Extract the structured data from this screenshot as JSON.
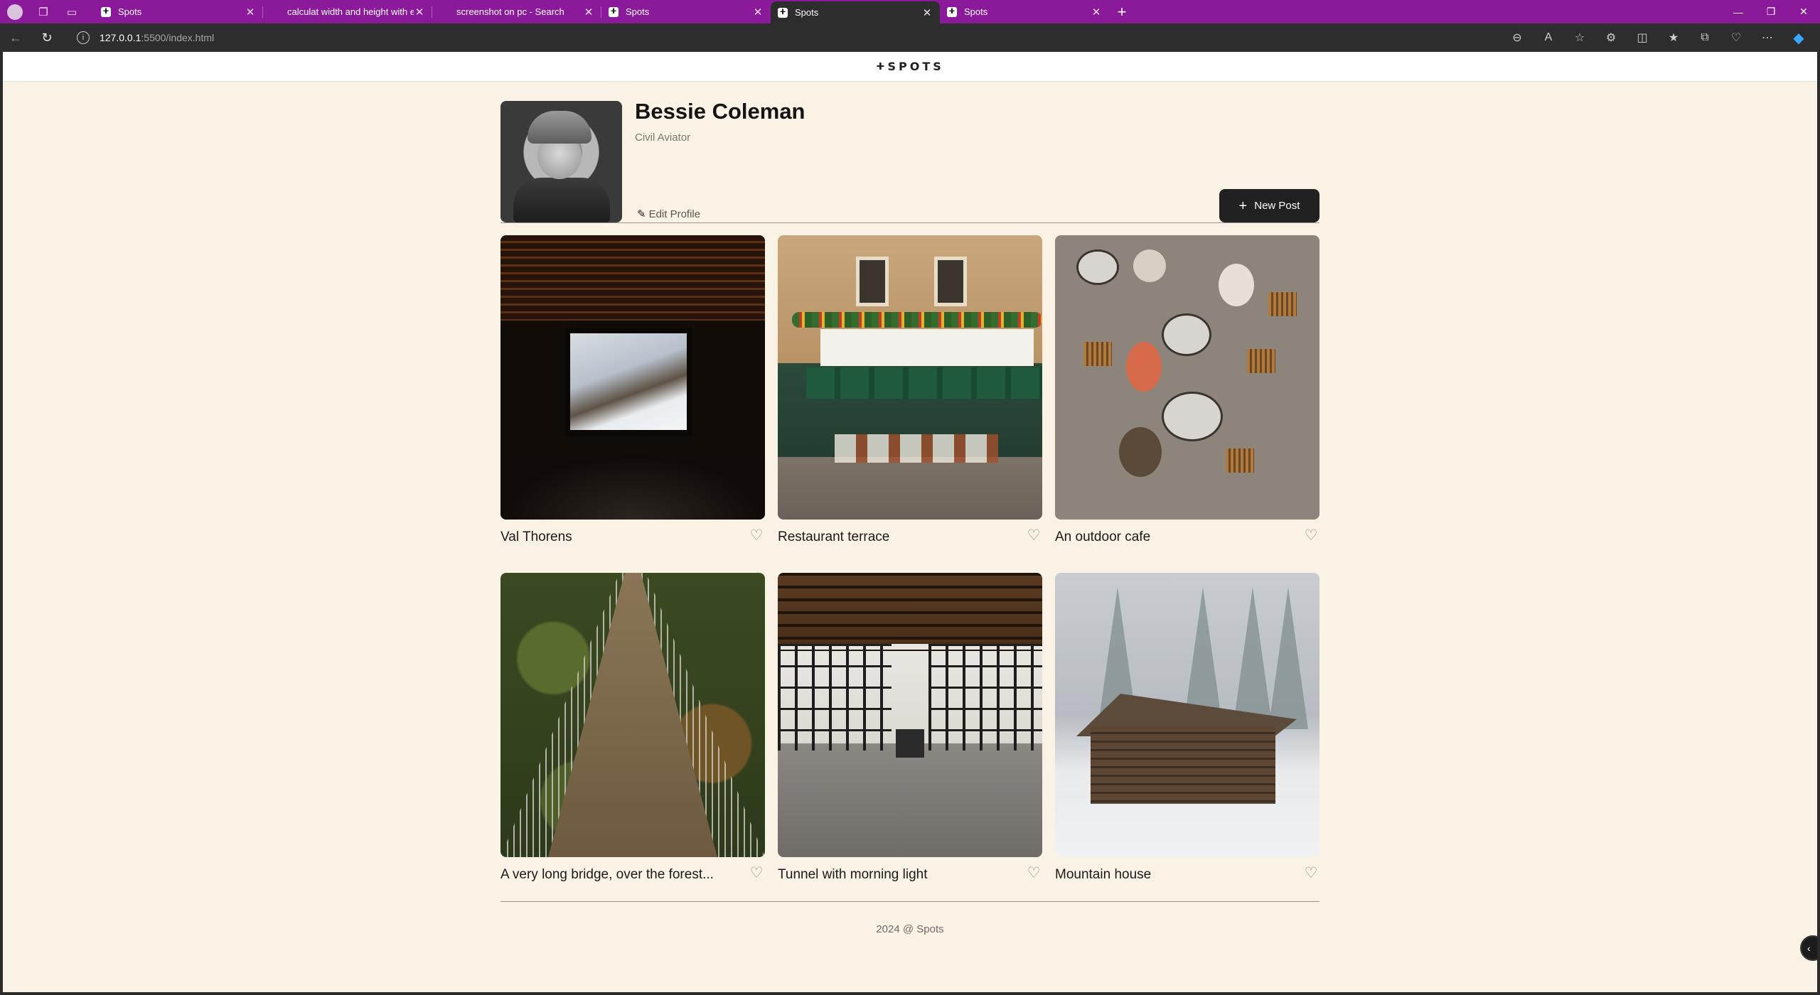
{
  "browser": {
    "tabs": [
      {
        "title": "Spots",
        "favicon": "spots-logo"
      },
      {
        "title": "calculat width and height with em",
        "favicon": "none"
      },
      {
        "title": "screenshot on pc - Search",
        "favicon": "none"
      },
      {
        "title": "Spots",
        "favicon": "spots-logo"
      },
      {
        "title": "Spots",
        "favicon": "spots-logo",
        "active": true
      },
      {
        "title": "Spots",
        "favicon": "spots-logo"
      }
    ],
    "address": {
      "host": "127.0.0.1",
      "path": ":5500/index.html"
    },
    "colors": {
      "tabbar": "#8b1a9b",
      "toolbar": "#2d2d2d"
    }
  },
  "site": {
    "logo": "SPOTS",
    "logo_mark": "ⵜ"
  },
  "profile": {
    "name": "Bessie Coleman",
    "title": "Civil Aviator",
    "edit_label": "Edit Profile",
    "new_post_label": "New Post"
  },
  "cards": [
    {
      "title": "Val Thorens",
      "image": "snowy-window-view"
    },
    {
      "title": "Restaurant terrace",
      "image": "paris-restaurant-facade"
    },
    {
      "title": "An outdoor cafe",
      "image": "cafe-tables-overhead"
    },
    {
      "title": "A very long bridge, over the forest...",
      "image": "suspension-bridge-forest"
    },
    {
      "title": "Tunnel with morning light",
      "image": "glass-tunnel-walkway"
    },
    {
      "title": "Mountain house",
      "image": "wooden-hut-snow"
    }
  ],
  "footer": {
    "text": "2024 @ Spots"
  },
  "colors": {
    "page_bg": "#faf2e4",
    "button_bg": "#212121",
    "text": "#212121"
  }
}
